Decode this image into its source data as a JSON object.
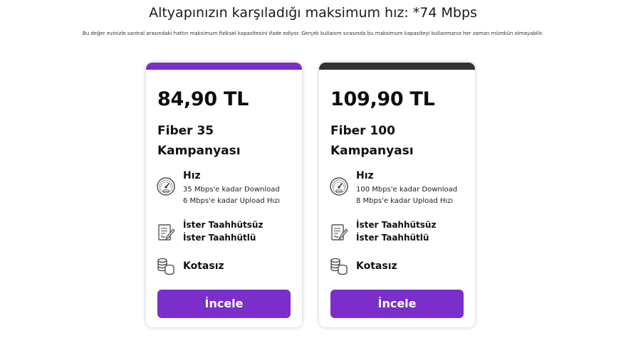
{
  "header": {
    "title": "Altyapınızın karşıladığı maksimum hız: *74 Mbps",
    "description": "Bu değer evinizle santral arasındaki hattın maksimum fiziksel kapasitesini ifade ediyor. Gerçek kullanım sırasında bu maksimum kapasiteyi kullanmanız her zaman mümkün olmayabilir."
  },
  "colors": {
    "accent": "#7b2ec9",
    "card_bar_first": "#7b2ec9",
    "card_bar_second": "#333333",
    "button_text": "#ffffff"
  },
  "cards": [
    {
      "price": "84,90 TL",
      "name_line1": "Fiber 35",
      "name_line2": "Kampanyası",
      "speed_title": "Hız",
      "download": "35 Mbps'e kadar Download",
      "upload": "6 Mbps'e kadar Upload Hızı",
      "contract_line1": "İster Taahhütsüz",
      "contract_line2": "İster Taahhütlü",
      "quota": "Kotasız",
      "button_label": "İncele",
      "icons": [
        "speedometer-icon",
        "contract-icon",
        "coins-icon"
      ]
    },
    {
      "price": "109,90 TL",
      "name_line1": "Fiber 100",
      "name_line2": "Kampanyası",
      "speed_title": "Hız",
      "download": "100 Mbps'e kadar Download",
      "upload": "8 Mbps'e kadar Upload Hızı",
      "contract_line1": "İster Taahhütsüz",
      "contract_line2": "İster Taahhütlü",
      "quota": "Kotasız",
      "button_label": "İncele",
      "icons": [
        "speedometer-icon",
        "contract-icon",
        "coins-icon"
      ]
    }
  ]
}
